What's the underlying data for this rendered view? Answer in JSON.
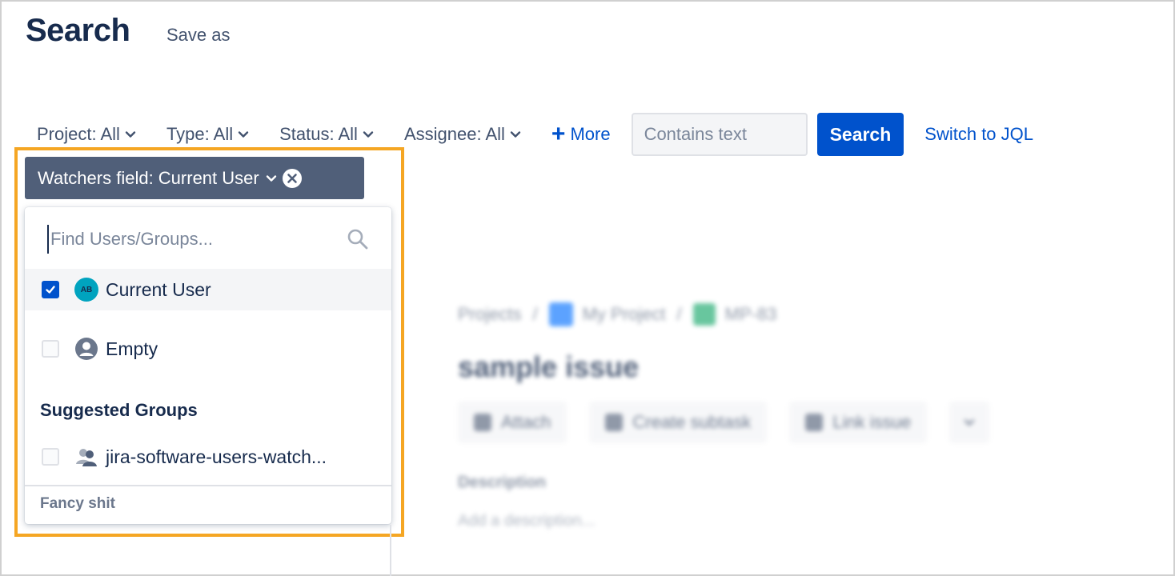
{
  "header": {
    "title": "Search",
    "save_as": "Save as"
  },
  "filters": {
    "project": "Project: All",
    "type": "Type: All",
    "status": "Status: All",
    "assignee": "Assignee: All",
    "more": "More",
    "text_placeholder": "Contains text",
    "search_button": "Search",
    "switch_jql": "Switch to JQL"
  },
  "watchers_chip": {
    "label": "Watchers field: Current User"
  },
  "dropdown": {
    "find_placeholder": "Find Users/Groups...",
    "options": [
      {
        "label": "Current User",
        "checked": true,
        "avatar_initials": "AB"
      },
      {
        "label": "Empty",
        "checked": false
      }
    ],
    "suggested_heading": "Suggested Groups",
    "groups": [
      {
        "label": "jira-software-users-watch...",
        "checked": false
      }
    ],
    "footer": "Fancy shit"
  },
  "issue": {
    "breadcrumb": [
      "Projects",
      "My Project",
      "MP-83"
    ],
    "title": "sample issue",
    "actions": [
      "Attach",
      "Create subtask",
      "Link issue"
    ],
    "description_label": "Description",
    "description_placeholder": "Add a description..."
  },
  "colors": {
    "primary": "#0052CC",
    "chip_bg": "#505F79",
    "highlight": "#F5A623",
    "text": "#172B4D"
  }
}
